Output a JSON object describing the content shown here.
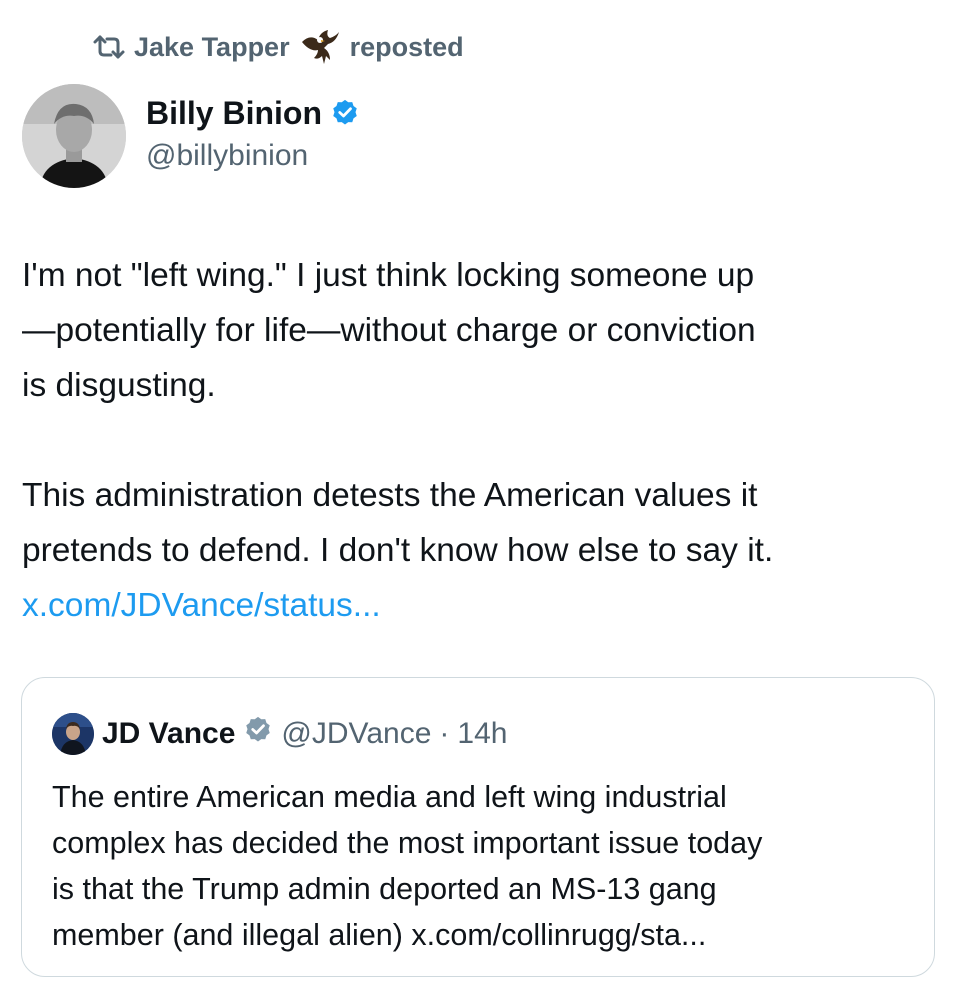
{
  "repost": {
    "reposter_name": "Jake Tapper",
    "label": "reposted",
    "icon": "repost-icon",
    "badge_icon": "eagle-icon"
  },
  "tweet": {
    "author_name": "Billy Binion",
    "author_handle": "@billybinion",
    "verified": true,
    "paragraph1": "I'm not \"left wing.\" I just think locking someone up\n—potentially for life—without charge or conviction\nis disgusting.",
    "paragraph2": "This administration detests the American values it\npretends to defend. I don't know how else to say it.",
    "link": "x.com/JDVance/status..."
  },
  "quote": {
    "author_name": "JD Vance",
    "author_handle": "@JDVance",
    "separator": "·",
    "time": "14h",
    "verified_color": "#829aab",
    "text": "The entire American media and left wing industrial\ncomplex has decided the most important issue today\nis that the Trump admin deported an MS-13 gang\nmember (and illegal alien) x.com/collinrugg/sta..."
  },
  "colors": {
    "text": "#0f1419",
    "secondary": "#536471",
    "link": "#1d9bf0",
    "verified": "#1d9bf0",
    "border": "#cfd9de"
  }
}
